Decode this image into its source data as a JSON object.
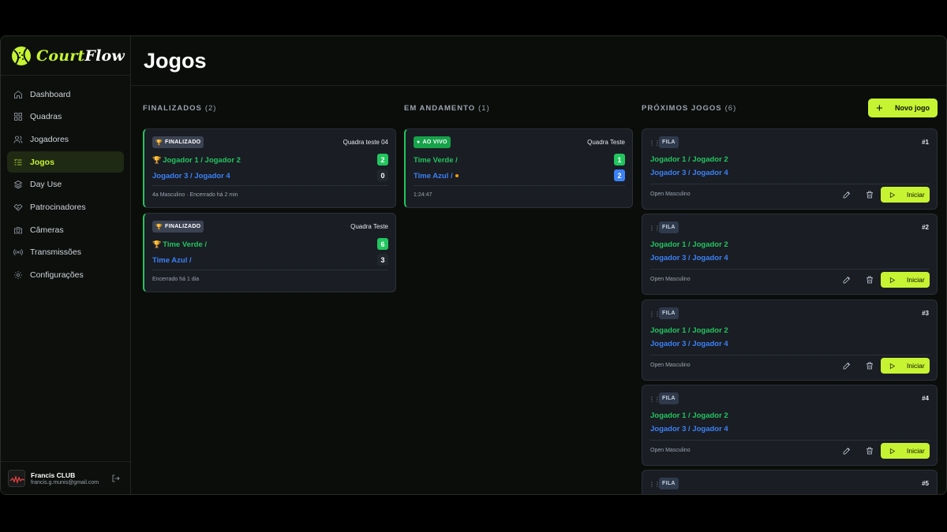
{
  "brand": {
    "name_part1": "Court",
    "name_part2": "Flow"
  },
  "sidebar": {
    "items": [
      {
        "label": "Dashboard",
        "icon": "home-icon"
      },
      {
        "label": "Quadras",
        "icon": "grid-icon"
      },
      {
        "label": "Jogadores",
        "icon": "users-icon"
      },
      {
        "label": "Jogos",
        "icon": "list-icon",
        "active": true
      },
      {
        "label": "Day Use",
        "icon": "layers-icon"
      },
      {
        "label": "Patrocinadores",
        "icon": "handshake-icon"
      },
      {
        "label": "Câmeras",
        "icon": "camera-icon"
      },
      {
        "label": "Transmissões",
        "icon": "broadcast-icon"
      },
      {
        "label": "Configurações",
        "icon": "gear-icon"
      }
    ]
  },
  "user": {
    "name": "Francis CLUB",
    "email": "francis.g.munis@gmail.com"
  },
  "page": {
    "title": "Jogos"
  },
  "columns": {
    "finished": {
      "title": "FINALIZADOS",
      "count": "(2)"
    },
    "live": {
      "title": "EM ANDAMENTO",
      "count": "(1)"
    },
    "upcoming": {
      "title": "PRÓXIMOS JOGOS",
      "count": "(6)"
    }
  },
  "new_game_button": "Novo jogo",
  "finished_games": [
    {
      "badge": "FINALIZADO",
      "court": "Quadra teste 04",
      "team1": "Jogador 1 / Jogador 2",
      "score1": "2",
      "team2": "Jogador 3 / Jogador 4",
      "score2": "0",
      "meta": "4a Masculino · Encerrado há 2 min"
    },
    {
      "badge": "FINALIZADO",
      "court": "Quadra Teste",
      "team1": "Time Verde /",
      "score1": "6",
      "team2": "Time Azul /",
      "score2": "3",
      "meta": "Encerrado há 1 dia"
    }
  ],
  "live_games": [
    {
      "badge": "AO VIVO",
      "court": "Quadra Teste",
      "team1": "Time Verde /",
      "score1": "1",
      "team2": "Time Azul /",
      "score2": "2",
      "meta": "1:24:47"
    }
  ],
  "upcoming_games": [
    {
      "badge": "FILA",
      "num": "#1",
      "team1": "Jogador 1 / Jogador 2",
      "team2": "Jogador 3 / Jogador 4",
      "meta": "Open Masculino",
      "action": "Iniciar"
    },
    {
      "badge": "FILA",
      "num": "#2",
      "team1": "Jogador 1 / Jogador 2",
      "team2": "Jogador 3 / Jogador 4",
      "meta": "Open Masculino",
      "action": "Iniciar"
    },
    {
      "badge": "FILA",
      "num": "#3",
      "team1": "Jogador 1 / Jogador 2",
      "team2": "Jogador 3 / Jogador 4",
      "meta": "Open Masculino",
      "action": "Iniciar"
    },
    {
      "badge": "FILA",
      "num": "#4",
      "team1": "Jogador 1 / Jogador 2",
      "team2": "Jogador 3 / Jogador 4",
      "meta": "Open Masculino",
      "action": "Iniciar"
    },
    {
      "badge": "FILA",
      "num": "#5"
    }
  ],
  "colors": {
    "accent": "#c6f432",
    "green": "#22c55e",
    "blue": "#3b82f6",
    "card": "#1a1d24"
  }
}
